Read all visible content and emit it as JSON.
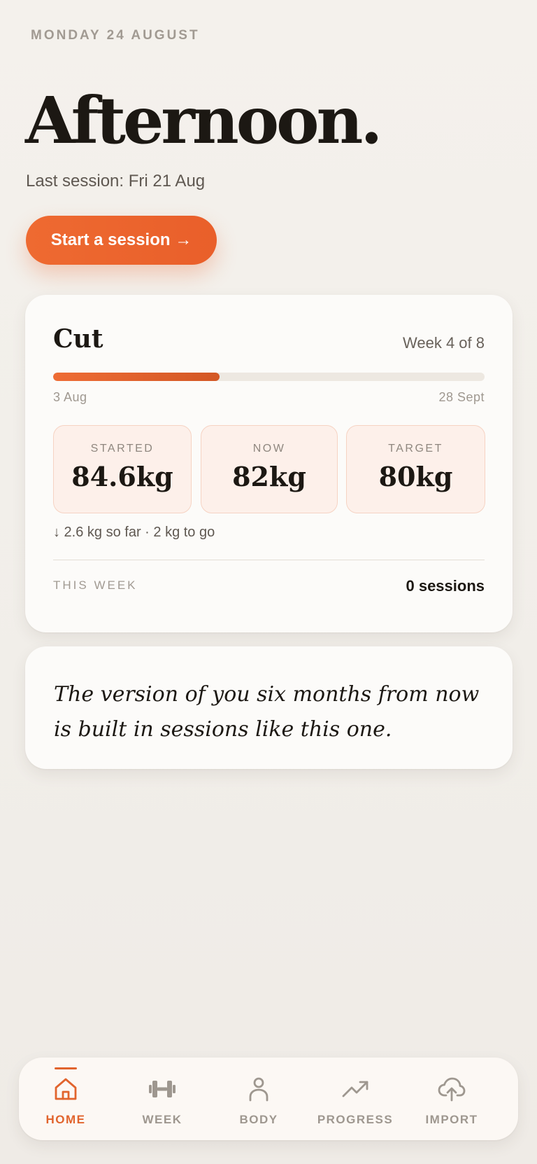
{
  "header": {
    "date": "MONDAY 24 AUGUST",
    "greeting": "Afternoon.",
    "last_session": "Last session: Fri 21 Aug",
    "start_button": "Start a session →"
  },
  "phase_card": {
    "title": "Cut",
    "week": "Week 4 of 8",
    "progress": 0.385,
    "start_date": "3 Aug",
    "end_date": "28 Sept",
    "stats": [
      {
        "label": "STARTED",
        "value": "84.6kg"
      },
      {
        "label": "NOW",
        "value": "82kg"
      },
      {
        "label": "TARGET",
        "value": "80kg"
      }
    ],
    "delta": "↓ 2.6 kg so far · 2 kg to go",
    "this_week_label": "THIS WEEK",
    "sessions": "0 sessions"
  },
  "quote": {
    "text": "The version of you six months from now is built in sessions like this one."
  },
  "nav": {
    "active": "home",
    "items": [
      {
        "id": "home",
        "label": "HOME",
        "icon": "home-icon"
      },
      {
        "id": "week",
        "label": "WEEK",
        "icon": "dumbbell-icon"
      },
      {
        "id": "body",
        "label": "BODY",
        "icon": "person-icon"
      },
      {
        "id": "progress",
        "label": "PROGRESS",
        "icon": "trend-up-icon"
      },
      {
        "id": "import",
        "label": "IMPORT",
        "icon": "cloud-upload-icon"
      }
    ]
  },
  "colors": {
    "accent": "#e9632d",
    "inactive": "#9e978f",
    "background": "#f2efea"
  }
}
